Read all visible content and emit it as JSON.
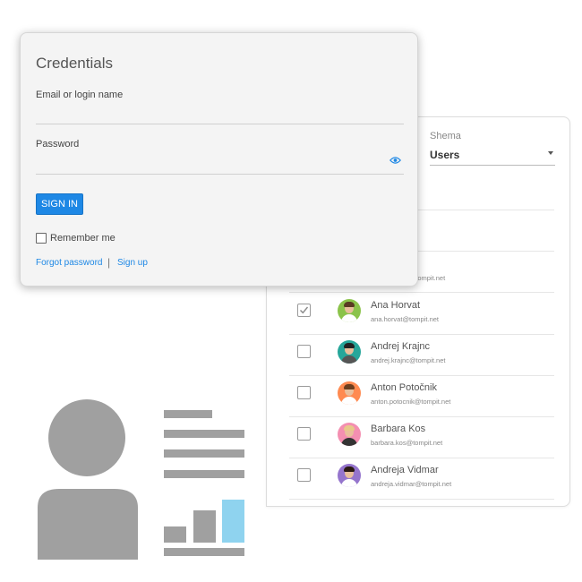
{
  "credentials": {
    "title": "Credentials",
    "email_label": "Email or login name",
    "email_value": "",
    "password_label": "Password",
    "password_value": "",
    "sign_in_label": "SIGN IN",
    "remember_label": "Remember me",
    "remember_checked": false,
    "forgot_label": "Forgot password",
    "separator": "|",
    "signup_label": "Sign up"
  },
  "users_panel": {
    "schema_label": "Shema",
    "schema_value": "Users",
    "partial_email": "...tompit.net",
    "rows": [
      {
        "name": "Ana Horvat",
        "email": "ana.horvat@tompit.net",
        "checked": true
      },
      {
        "name": "Andrej Krajnc",
        "email": "andrej.krajnc@tompit.net",
        "checked": false
      },
      {
        "name": "Anton Potočnik",
        "email": "anton.potocnik@tompit.net",
        "checked": false
      },
      {
        "name": "Barbara Kos",
        "email": "barbara.kos@tompit.net",
        "checked": false
      },
      {
        "name": "Andreja Vidmar",
        "email": "andreja.vidmar@tompit.net",
        "checked": false
      }
    ]
  },
  "colors": {
    "accent": "#1e88e5",
    "illustration_gray": "#a0a0a0",
    "illustration_highlight": "#8fd3ef"
  },
  "icons": {
    "password_toggle": "eye-icon",
    "illustration_person": "person-icon",
    "illustration_chart": "bar-chart-icon"
  }
}
